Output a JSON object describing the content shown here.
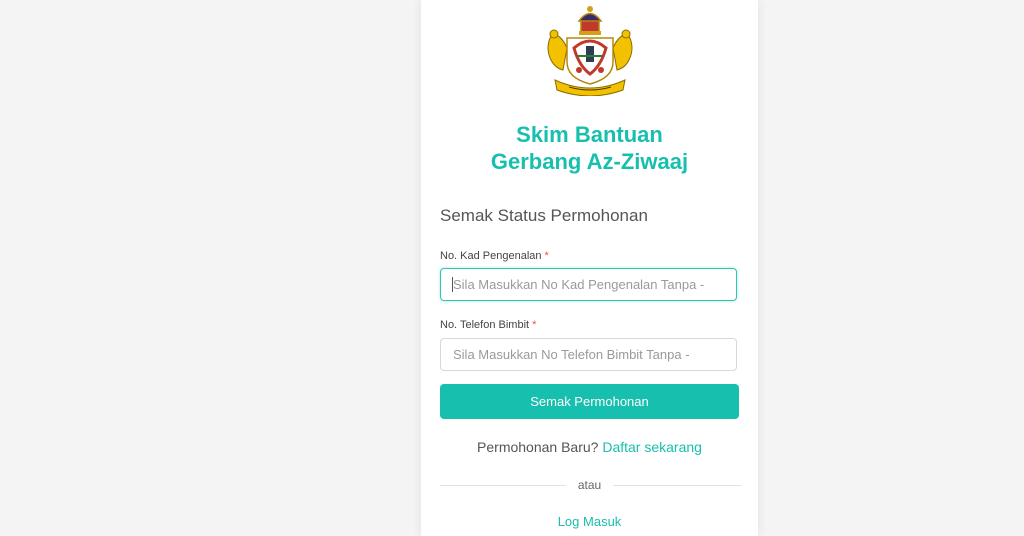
{
  "header": {
    "crest_icon": "state-coat-of-arms-icon",
    "title_line1": "Skim Bantuan",
    "title_line2": "Gerbang Az-Ziwaaj"
  },
  "form": {
    "section_title": "Semak Status Permohonan",
    "ic_label": "No. Kad Pengenalan",
    "ic_placeholder": "Sila Masukkan No Kad Pengenalan Tanpa -",
    "phone_label": "No. Telefon Bimbit",
    "phone_placeholder": "Sila Masukkan No Telefon Bimbit Tanpa -",
    "required_mark": "*",
    "submit_label": "Semak Permohonan"
  },
  "footer": {
    "register_prompt": "Permohonan Baru?",
    "register_link": "Daftar sekarang",
    "divider_text": "atau",
    "login_link": "Log Masuk"
  },
  "colors": {
    "accent": "#17bfae",
    "background": "#f4f4f4",
    "required": "#e5534b"
  }
}
